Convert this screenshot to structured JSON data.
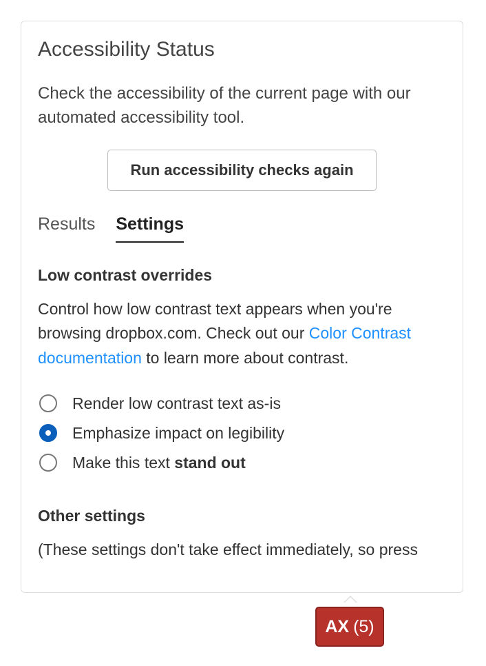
{
  "panel": {
    "title": "Accessibility Status",
    "description": "Check the accessibility of the current page with our automated accessibility tool.",
    "run_button": "Run accessibility checks again",
    "tabs": {
      "results": "Results",
      "settings": "Settings",
      "active": "settings"
    },
    "low_contrast": {
      "heading": "Low contrast overrides",
      "para_pre": "Control how low contrast text appears when you're browsing dropbox.com. Check out our ",
      "link": "Color Contrast documentation",
      "para_post": " to learn more about contrast.",
      "options": [
        {
          "label_pre": "Render low contrast text as-is",
          "label_bold": "",
          "selected": false
        },
        {
          "label_pre": "Emphasize impact on legibility",
          "label_bold": "",
          "selected": true
        },
        {
          "label_pre": "Make this text ",
          "label_bold": "stand out",
          "selected": false
        }
      ]
    },
    "other": {
      "heading": "Other settings",
      "note": "(These settings don't take effect immediately, so press"
    }
  },
  "badge": {
    "label": "AX",
    "count": "(5)"
  }
}
